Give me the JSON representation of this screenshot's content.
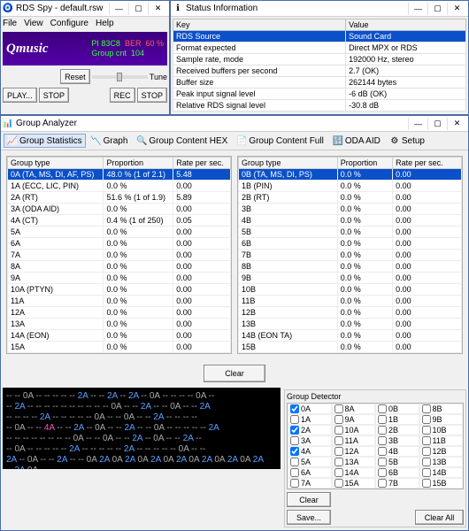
{
  "rdsspy": {
    "title": "RDS Spy - default.rsw",
    "menu": [
      "File",
      "View",
      "Configure",
      "Help"
    ],
    "logo": "Qmusic",
    "pi_label": "PI",
    "pi_value": "83C8",
    "ber_label": "BER",
    "ber_value": "60 %",
    "groupcnt_label": "Group cnt",
    "groupcnt_value": "104",
    "reset": "Reset",
    "tune": "Tune",
    "play": "PLAY...",
    "stop1": "STOP",
    "rec": "REC",
    "stop2": "STOP"
  },
  "status": {
    "title": "Status Information",
    "head_key": "Key",
    "head_val": "Value",
    "rows": [
      {
        "k": "RDS Source",
        "v": "Sound Card",
        "sel": true
      },
      {
        "k": "Format expected",
        "v": "Direct MPX or RDS"
      },
      {
        "k": "Sample rate, mode",
        "v": "192000 Hz, stereo"
      },
      {
        "k": "Received buffers per second",
        "v": "2.7 (OK)"
      },
      {
        "k": "Buffer size",
        "v": "262144 bytes"
      },
      {
        "k": "Peak input signal level",
        "v": "-6 dB (OK)"
      },
      {
        "k": "Relative RDS signal level",
        "v": "-30.8 dB"
      }
    ]
  },
  "analyzer": {
    "title": "Group Analyzer",
    "tool": {
      "stats": "Group Statistics",
      "graph": "Graph",
      "hex": "Group Content HEX",
      "full": "Group Content Full",
      "oda": "ODA AID",
      "setup": "Setup"
    },
    "head_type": "Group type",
    "head_prop": "Proportion",
    "head_rate": "Rate per sec.",
    "left": [
      {
        "t": "0A (TA, MS, DI, AF, PS)",
        "p": "48.0 %  (1 of 2.1)",
        "r": "5.48",
        "sel": true
      },
      {
        "t": "1A (ECC, LIC, PIN)",
        "p": "0.0 %",
        "r": "0.00"
      },
      {
        "t": "2A (RT)",
        "p": "51.6 %  (1 of 1.9)",
        "r": "5.89"
      },
      {
        "t": "3A (ODA AID)",
        "p": "0.0 %",
        "r": "0.00"
      },
      {
        "t": "4A (CT)",
        "p": "0.4 %  (1 of 250)",
        "r": "0.05"
      },
      {
        "t": "5A",
        "p": "0.0 %",
        "r": "0.00"
      },
      {
        "t": "6A",
        "p": "0.0 %",
        "r": "0.00"
      },
      {
        "t": "7A",
        "p": "0.0 %",
        "r": "0.00"
      },
      {
        "t": "8A",
        "p": "0.0 %",
        "r": "0.00"
      },
      {
        "t": "9A",
        "p": "0.0 %",
        "r": "0.00"
      },
      {
        "t": "10A (PTYN)",
        "p": "0.0 %",
        "r": "0.00"
      },
      {
        "t": "11A",
        "p": "0.0 %",
        "r": "0.00"
      },
      {
        "t": "12A",
        "p": "0.0 %",
        "r": "0.00"
      },
      {
        "t": "13A",
        "p": "0.0 %",
        "r": "0.00"
      },
      {
        "t": "14A (EON)",
        "p": "0.0 %",
        "r": "0.00"
      },
      {
        "t": "15A",
        "p": "0.0 %",
        "r": "0.00"
      }
    ],
    "right": [
      {
        "t": "0B (TA, MS, DI, PS)",
        "p": "0.0 %",
        "r": "0.00",
        "sel": true
      },
      {
        "t": "1B (PIN)",
        "p": "0.0 %",
        "r": "0.00"
      },
      {
        "t": "2B (RT)",
        "p": "0.0 %",
        "r": "0.00"
      },
      {
        "t": "3B",
        "p": "0.0 %",
        "r": "0.00"
      },
      {
        "t": "4B",
        "p": "0.0 %",
        "r": "0.00"
      },
      {
        "t": "5B",
        "p": "0.0 %",
        "r": "0.00"
      },
      {
        "t": "6B",
        "p": "0.0 %",
        "r": "0.00"
      },
      {
        "t": "7B",
        "p": "0.0 %",
        "r": "0.00"
      },
      {
        "t": "8B",
        "p": "0.0 %",
        "r": "0.00"
      },
      {
        "t": "9B",
        "p": "0.0 %",
        "r": "0.00"
      },
      {
        "t": "10B",
        "p": "0.0 %",
        "r": "0.00"
      },
      {
        "t": "11B",
        "p": "0.0 %",
        "r": "0.00"
      },
      {
        "t": "12B",
        "p": "0.0 %",
        "r": "0.00"
      },
      {
        "t": "13B",
        "p": "0.0 %",
        "r": "0.00"
      },
      {
        "t": "14B (EON TA)",
        "p": "0.0 %",
        "r": "0.00"
      },
      {
        "t": "15B",
        "p": "0.0 %",
        "r": "0.00"
      }
    ],
    "clear": "Clear",
    "hexdump": [
      [
        "--",
        "--",
        "0A",
        "--",
        "--",
        "--",
        "--",
        "--",
        "2A",
        "--",
        "--",
        "2A",
        "--",
        "",
        "2A",
        "--",
        "0A",
        "--",
        "--",
        "--",
        "--",
        "0A",
        "--"
      ],
      [
        "--",
        "2A",
        "--",
        "",
        "--",
        "--",
        "--",
        "--",
        "--",
        "--",
        "--",
        "--",
        "--",
        "0A",
        "--",
        "--",
        "2A",
        "--",
        "--",
        "0A",
        "--",
        "--",
        "2A"
      ],
      [
        "--",
        "--",
        "--",
        "--",
        "2A",
        "--",
        "",
        "--",
        "--",
        "--",
        "--",
        "0A",
        "--",
        "--",
        "0A",
        "--",
        "--",
        "2A",
        "--",
        "",
        "--",
        "--",
        "--"
      ],
      [
        "--",
        "0A",
        "--",
        "--",
        "4A",
        "--",
        "--",
        "2A",
        "--",
        "",
        "0A",
        "--",
        "--",
        "2A",
        "--",
        "--",
        "0A",
        "--",
        "--",
        "--",
        "--",
        "--",
        "2A"
      ],
      [
        "--",
        "",
        "--",
        "--",
        "--",
        "--",
        "--",
        "--",
        "--",
        "0A",
        "--",
        "--",
        "0A",
        "--",
        "--",
        "2A",
        "--",
        "",
        "0A",
        "--",
        "--",
        "2A",
        "--"
      ],
      [
        "--",
        "0A",
        "--",
        "--",
        "--",
        "--",
        "--",
        "2A",
        "--",
        "",
        "--",
        "--",
        "--",
        "--",
        "2A",
        "--",
        "--",
        "--",
        "--",
        "--",
        "0A",
        "--",
        "--"
      ],
      [
        "2A",
        "--",
        "",
        "0A",
        "--",
        "--",
        "2A",
        "--",
        "--",
        "0A",
        "2A",
        "0A",
        "2A",
        "0A",
        "2A",
        "0A",
        "2A",
        "0A",
        "2A",
        "0A",
        "2A",
        "0A",
        "2A"
      ],
      [
        "--",
        "2A",
        "0A"
      ]
    ],
    "detector": {
      "title": "Group Detector",
      "items": [
        {
          "l": "0A",
          "c": true
        },
        {
          "l": "8A",
          "c": false
        },
        {
          "l": "0B",
          "c": false
        },
        {
          "l": "8B",
          "c": false
        },
        {
          "l": "1A",
          "c": false
        },
        {
          "l": "9A",
          "c": false
        },
        {
          "l": "1B",
          "c": false
        },
        {
          "l": "9B",
          "c": false
        },
        {
          "l": "2A",
          "c": true
        },
        {
          "l": "10A",
          "c": false
        },
        {
          "l": "2B",
          "c": false
        },
        {
          "l": "10B",
          "c": false
        },
        {
          "l": "3A",
          "c": false
        },
        {
          "l": "11A",
          "c": false
        },
        {
          "l": "3B",
          "c": false
        },
        {
          "l": "11B",
          "c": false
        },
        {
          "l": "4A",
          "c": true
        },
        {
          "l": "12A",
          "c": false
        },
        {
          "l": "4B",
          "c": false
        },
        {
          "l": "12B",
          "c": false
        },
        {
          "l": "5A",
          "c": false
        },
        {
          "l": "13A",
          "c": false
        },
        {
          "l": "5B",
          "c": false
        },
        {
          "l": "13B",
          "c": false
        },
        {
          "l": "6A",
          "c": false
        },
        {
          "l": "14A",
          "c": false
        },
        {
          "l": "6B",
          "c": false
        },
        {
          "l": "14B",
          "c": false
        },
        {
          "l": "7A",
          "c": false
        },
        {
          "l": "15A",
          "c": false
        },
        {
          "l": "7B",
          "c": false
        },
        {
          "l": "15B",
          "c": false
        }
      ],
      "clear": "Clear",
      "save": "Save...",
      "clearall": "Clear All"
    }
  }
}
